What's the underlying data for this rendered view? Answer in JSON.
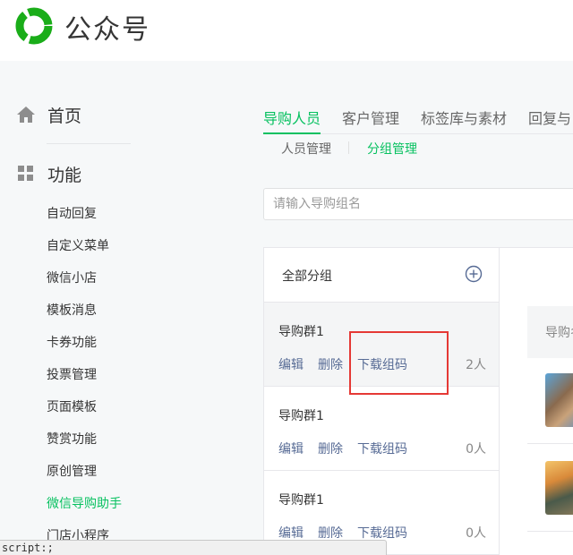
{
  "header": {
    "brand": "公众号"
  },
  "sidebar": {
    "home_label": "首页",
    "function_label": "功能",
    "items": [
      {
        "label": "自动回复"
      },
      {
        "label": "自定义菜单"
      },
      {
        "label": "微信小店"
      },
      {
        "label": "模板消息"
      },
      {
        "label": "卡券功能"
      },
      {
        "label": "投票管理"
      },
      {
        "label": "页面模板"
      },
      {
        "label": "赞赏功能"
      },
      {
        "label": "原创管理"
      },
      {
        "label": "微信导购助手",
        "active": true
      },
      {
        "label": "门店小程序"
      }
    ]
  },
  "main_tabs": [
    {
      "label": "导购人员",
      "active": true
    },
    {
      "label": "客户管理"
    },
    {
      "label": "标签库与素材"
    },
    {
      "label": "回复与"
    }
  ],
  "sub_tabs": [
    {
      "label": "人员管理"
    },
    {
      "label": "分组管理",
      "active": true
    }
  ],
  "search": {
    "placeholder": "请输入导购组名",
    "value": ""
  },
  "group_panel": {
    "all_label": "全部分组",
    "actions": {
      "edit": "编辑",
      "delete": "删除",
      "download": "下载组码"
    },
    "groups": [
      {
        "name": "导购群1",
        "count": "2人",
        "selected": true
      },
      {
        "name": "导购群1",
        "count": "0人"
      },
      {
        "name": "导购群1",
        "count": "0人"
      }
    ]
  },
  "right_panel": {
    "header_text": "导购名"
  },
  "status_bar": {
    "text": "script:;"
  },
  "colors": {
    "accent": "#07c160",
    "link": "#576b95",
    "highlight": "#e53935"
  }
}
